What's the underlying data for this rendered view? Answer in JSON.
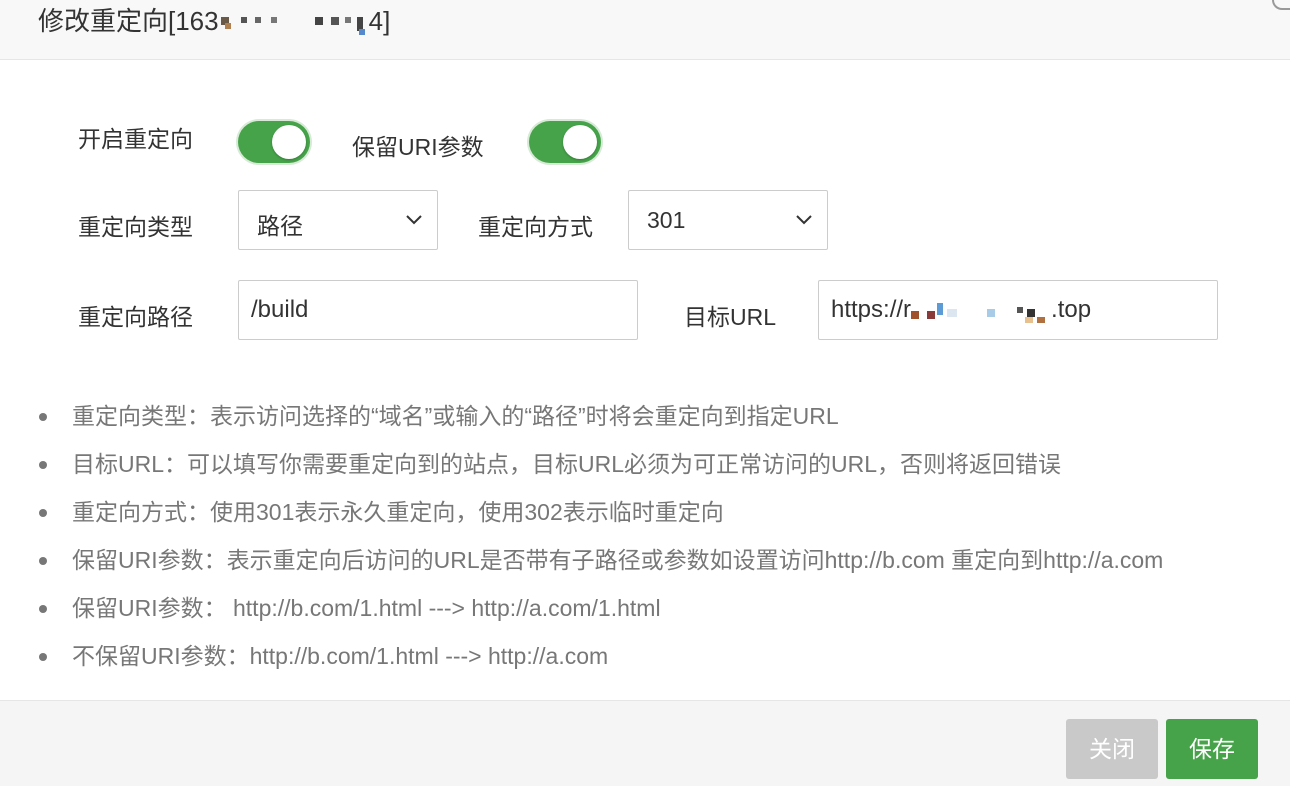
{
  "dialog": {
    "title_prefix": "修改重定向[163",
    "title_suffix": "4]"
  },
  "form": {
    "enable_redirect_label": "开启重定向",
    "enable_redirect_on": true,
    "keep_uri_label": "保留URI参数",
    "keep_uri_on": true,
    "redirect_type_label": "重定向类型",
    "redirect_type_value": "路径",
    "redirect_method_label": "重定向方式",
    "redirect_method_value": "301",
    "redirect_path_label": "重定向路径",
    "redirect_path_value": "/build",
    "target_url_label": "目标URL",
    "target_url_prefix": "https://r",
    "target_url_suffix": ".top"
  },
  "notes": [
    "重定向类型：表示访问选择的“域名”或输入的“路径”时将会重定向到指定URL",
    "目标URL：可以填写你需要重定向到的站点，目标URL必须为可正常访问的URL，否则将返回错误",
    "重定向方式：使用301表示永久重定向，使用302表示临时重定向",
    "保留URI参数：表示重定向后访问的URL是否带有子路径或参数如设置访问http://b.com 重定向到http://a.com",
    "保留URI参数： http://b.com/1.html ---> http://a.com/1.html",
    "不保留URI参数：http://b.com/1.html ---> http://a.com"
  ],
  "footer": {
    "close_label": "关闭",
    "save_label": "保存"
  },
  "colors": {
    "accent_green": "#46a34a",
    "disabled_gray": "#c9c9c9"
  }
}
